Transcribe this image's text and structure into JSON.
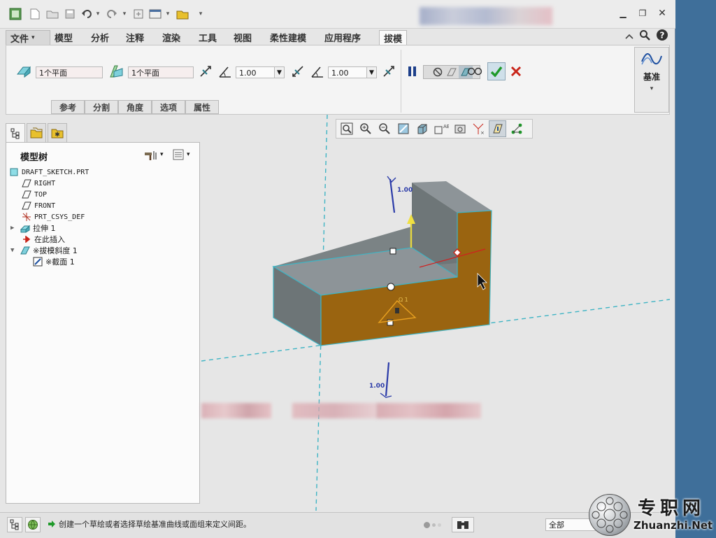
{
  "ribbon_tabs": {
    "file": "文件",
    "model": "模型",
    "analysis": "分析",
    "annotate": "注释",
    "render": "渲染",
    "tools": "工具",
    "view": "视图",
    "flexible_modeling": "柔性建模",
    "applications": "应用程序",
    "draft": "拔模"
  },
  "draft_ribbon": {
    "draft_surfaces_value": "1个平面",
    "draft_hinge_value": "1个平面",
    "angle1": "1.00",
    "angle2": "1.00",
    "subtabs": {
      "references": "参考",
      "split": "分割",
      "angles": "角度",
      "options": "选项",
      "properties": "属性"
    },
    "datum_label": "基准"
  },
  "model_tree": {
    "title": "模型树",
    "nodes": [
      {
        "label": "DRAFT_SKETCH.PRT"
      },
      {
        "label": "RIGHT"
      },
      {
        "label": "TOP"
      },
      {
        "label": "FRONT"
      },
      {
        "label": "PRT_CSYS_DEF"
      },
      {
        "label": "拉伸 1"
      },
      {
        "label": "在此插入"
      },
      {
        "label": "※拔模斜度 1"
      },
      {
        "label": "※截面 1"
      }
    ]
  },
  "viewport": {
    "dimension_top": "1.00",
    "dimension_bottom": "1.00",
    "angle_marker": "Ω 1"
  },
  "status_bar": {
    "message": "创建一个草绘或者选择草绘基准曲线或面组来定义间距。",
    "filter_value": "全部"
  },
  "watermark": {
    "chinese": "专职网",
    "domain": "Zhuanzhi.Net"
  },
  "colors": {
    "accent_orange": "#9a6410",
    "body_gray": "#7f8688",
    "top_gray": "#8d9498",
    "datum_cyan": "#3fb4c4",
    "dimension_blue": "#2a3aa8",
    "confirm_green": "#1f9a2a",
    "cancel_red": "#c8251a"
  }
}
